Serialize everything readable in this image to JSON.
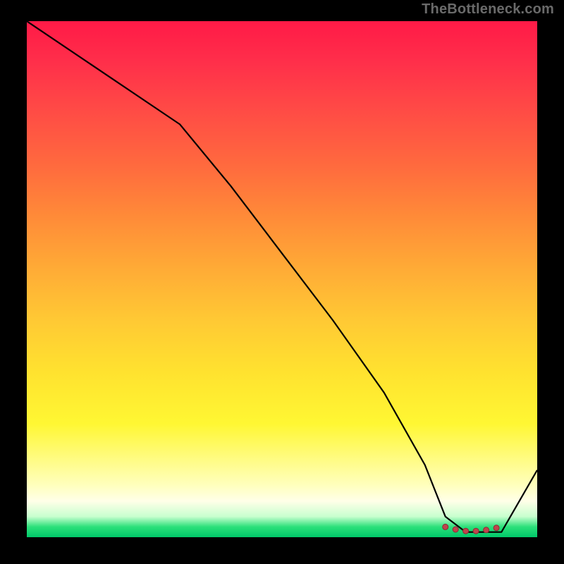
{
  "watermark": "TheBottleneck.com",
  "chart_data": {
    "type": "line",
    "title": "",
    "xlabel": "",
    "ylabel": "",
    "xlim": [
      0,
      100
    ],
    "ylim": [
      0,
      100
    ],
    "series": [
      {
        "name": "curve",
        "x": [
          0,
          30,
          40,
          50,
          60,
          70,
          78,
          82,
          86,
          90,
          93,
          100
        ],
        "values": [
          100,
          80,
          68,
          55,
          42,
          28,
          14,
          4,
          1,
          1,
          1,
          13
        ]
      }
    ],
    "markers": {
      "name": "highlight-region",
      "x": [
        82,
        84,
        86,
        88,
        90,
        92
      ],
      "values": [
        2,
        1.5,
        1.2,
        1.2,
        1.4,
        1.8
      ]
    },
    "gradient_stops": [
      {
        "pos": 0.0,
        "color": "#ff1a47"
      },
      {
        "pos": 0.08,
        "color": "#ff2f4a"
      },
      {
        "pos": 0.18,
        "color": "#ff4d45"
      },
      {
        "pos": 0.28,
        "color": "#ff6a3e"
      },
      {
        "pos": 0.38,
        "color": "#ff8b38"
      },
      {
        "pos": 0.48,
        "color": "#ffab36"
      },
      {
        "pos": 0.58,
        "color": "#ffc934"
      },
      {
        "pos": 0.68,
        "color": "#ffe22f"
      },
      {
        "pos": 0.78,
        "color": "#fff733"
      },
      {
        "pos": 0.9,
        "color": "#ffffbe"
      },
      {
        "pos": 0.93,
        "color": "#ffffe8"
      },
      {
        "pos": 0.96,
        "color": "#c8ffcf"
      },
      {
        "pos": 0.98,
        "color": "#2be07a"
      },
      {
        "pos": 1.0,
        "color": "#00c96a"
      }
    ]
  }
}
